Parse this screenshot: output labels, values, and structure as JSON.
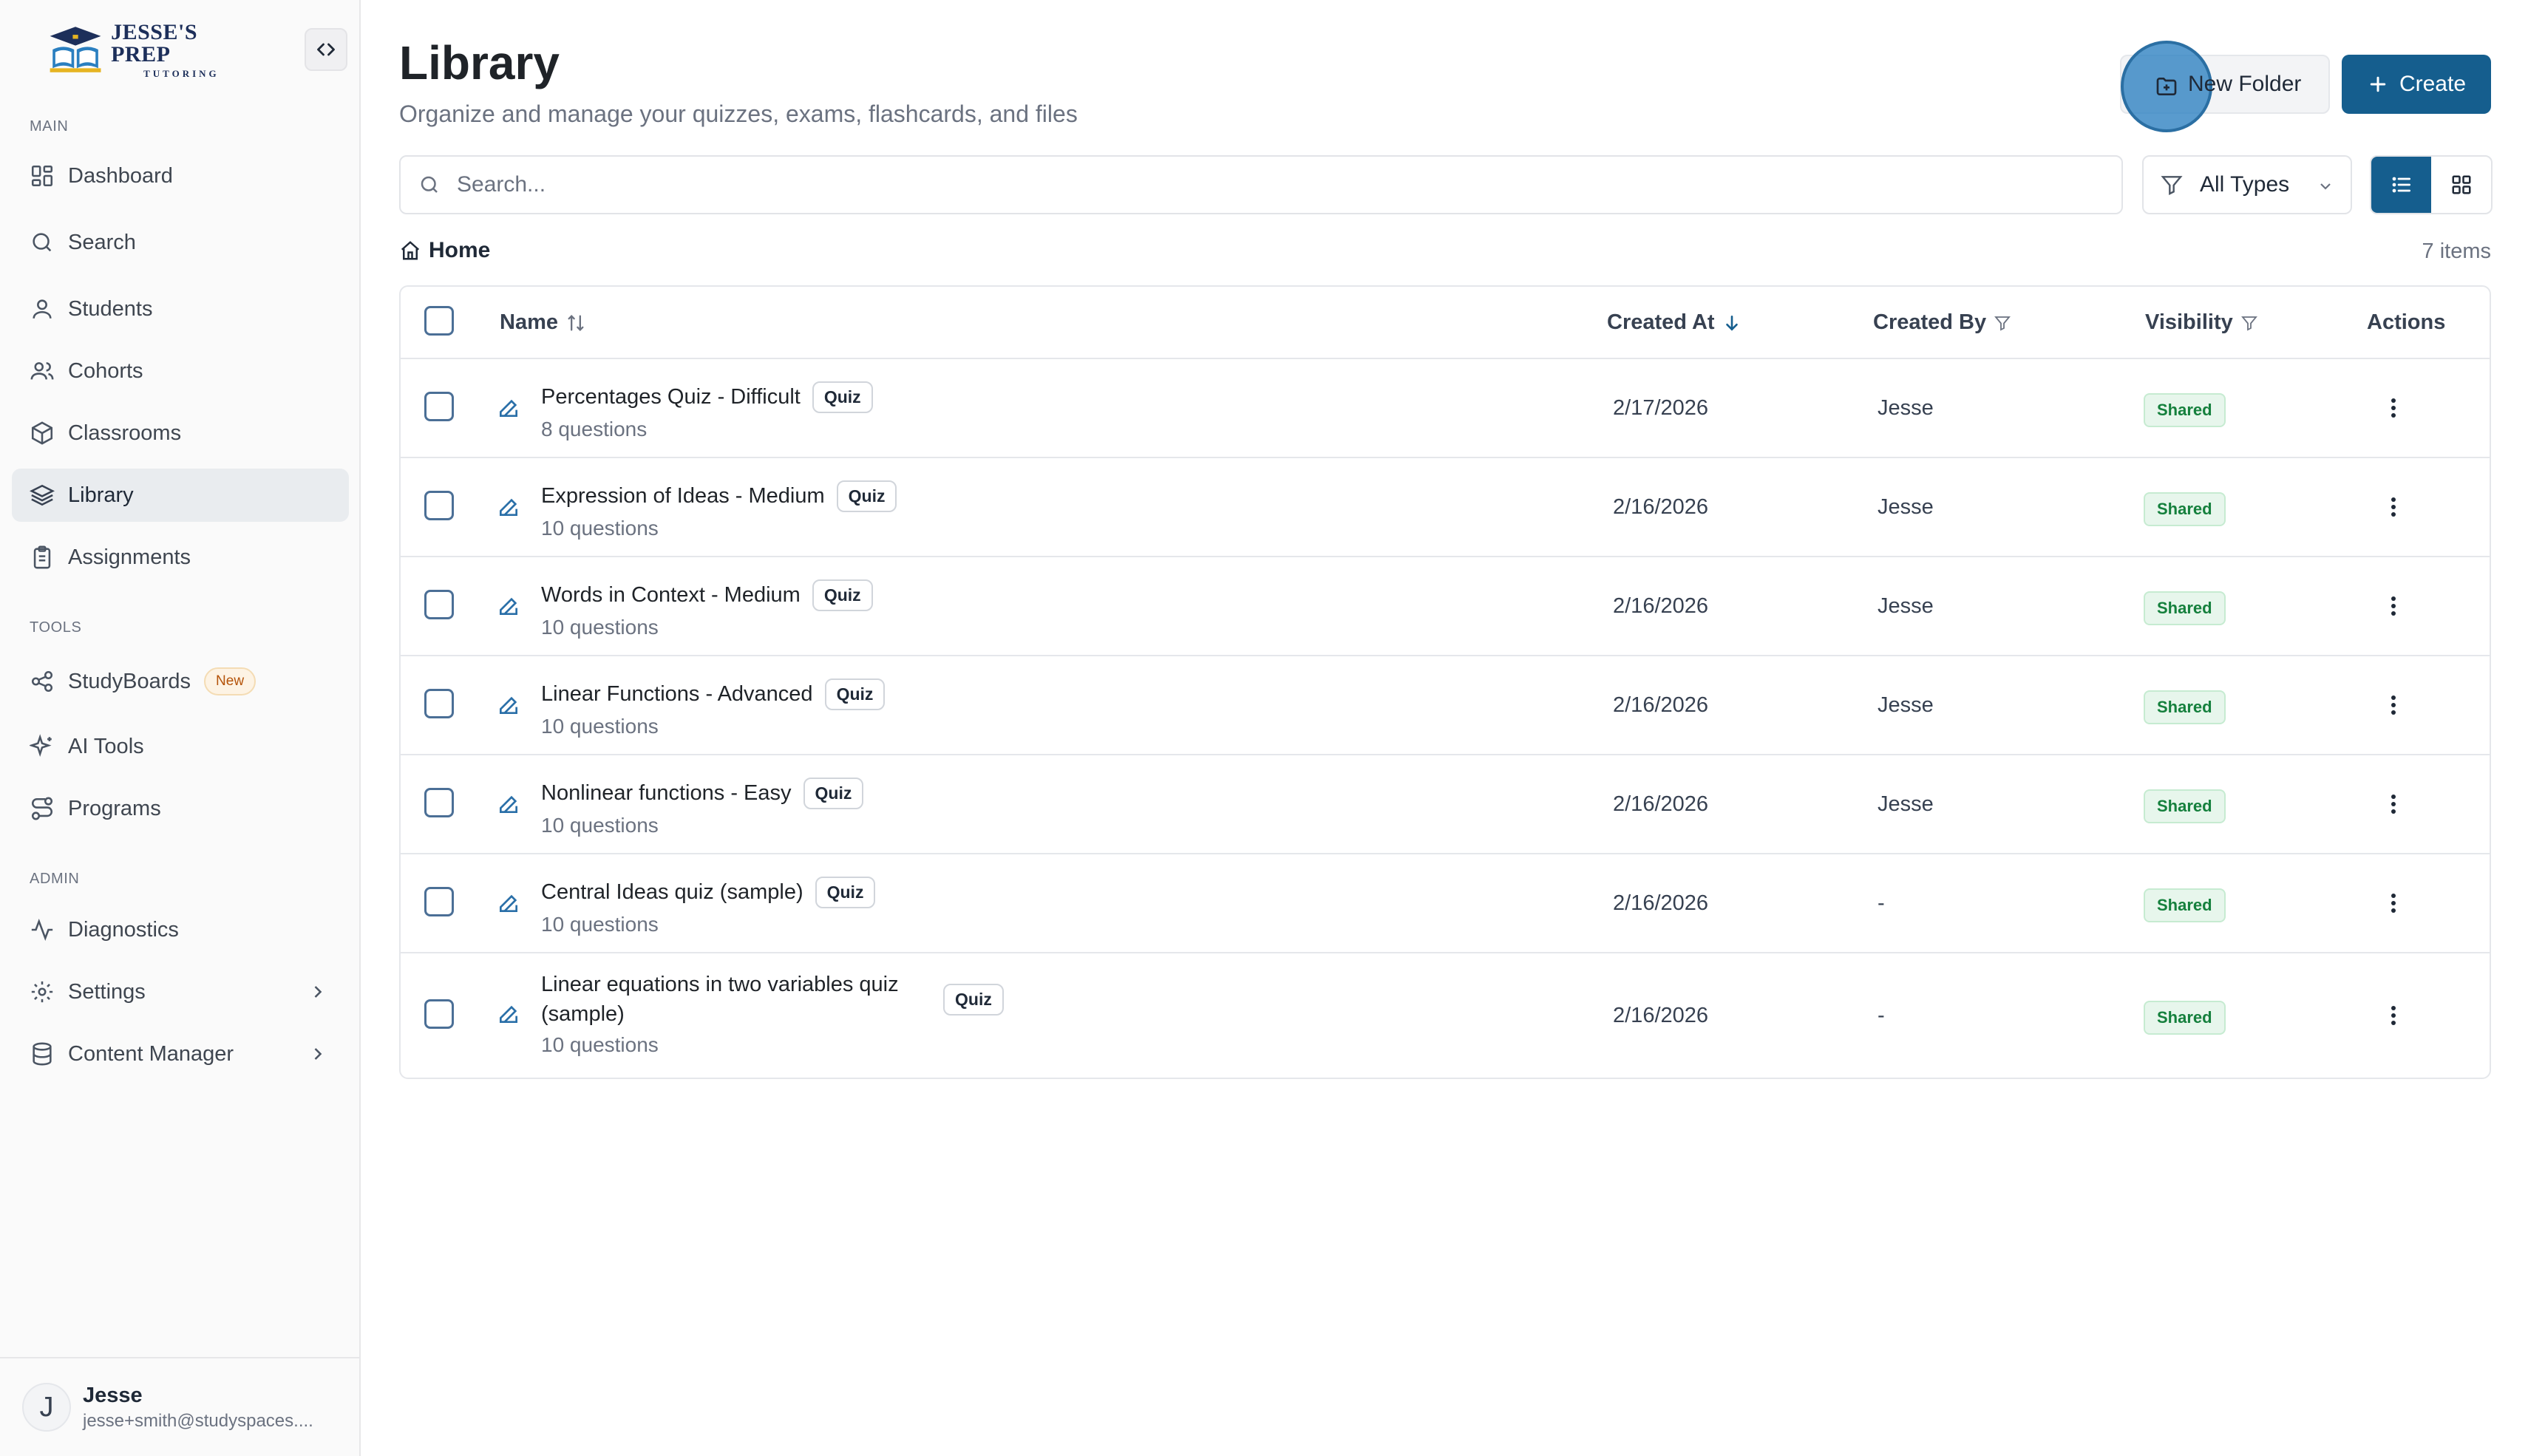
{
  "brand": {
    "title": "JESSE'S PREP",
    "subtitle": "TUTORING"
  },
  "sidebar": {
    "sections": {
      "main": "MAIN",
      "tools": "TOOLS",
      "admin": "ADMIN"
    },
    "items": {
      "dashboard": "Dashboard",
      "search": "Search",
      "students": "Students",
      "cohorts": "Cohorts",
      "classrooms": "Classrooms",
      "library": "Library",
      "assignments": "Assignments",
      "studyboards": "StudyBoards",
      "studyboards_badge": "New",
      "ai_tools": "AI Tools",
      "programs": "Programs",
      "diagnostics": "Diagnostics",
      "settings": "Settings",
      "content_manager": "Content Manager"
    },
    "user": {
      "initial": "J",
      "name": "Jesse",
      "email": "jesse+smith@studyspaces...."
    }
  },
  "header": {
    "title": "Library",
    "subtitle": "Organize and manage your quizzes, exams, flashcards, and files",
    "new_folder": "New Folder",
    "create": "Create"
  },
  "toolbar": {
    "search_placeholder": "Search...",
    "type_filter": "All Types"
  },
  "breadcrumb": {
    "home": "Home"
  },
  "count": "7 items",
  "table": {
    "columns": {
      "name": "Name",
      "created_at": "Created At",
      "created_by": "Created By",
      "visibility": "Visibility",
      "actions": "Actions"
    },
    "rows": [
      {
        "name": "Percentages Quiz - Difficult",
        "type": "Quiz",
        "sub": "8 questions",
        "date": "2/17/2026",
        "by": "Jesse",
        "visibility": "Shared"
      },
      {
        "name": "Expression of Ideas - Medium",
        "type": "Quiz",
        "sub": "10 questions",
        "date": "2/16/2026",
        "by": "Jesse",
        "visibility": "Shared"
      },
      {
        "name": "Words in Context - Medium",
        "type": "Quiz",
        "sub": "10 questions",
        "date": "2/16/2026",
        "by": "Jesse",
        "visibility": "Shared"
      },
      {
        "name": "Linear Functions - Advanced",
        "type": "Quiz",
        "sub": "10 questions",
        "date": "2/16/2026",
        "by": "Jesse",
        "visibility": "Shared"
      },
      {
        "name": "Nonlinear functions - Easy",
        "type": "Quiz",
        "sub": "10 questions",
        "date": "2/16/2026",
        "by": "Jesse",
        "visibility": "Shared"
      },
      {
        "name": "Central Ideas quiz (sample)",
        "type": "Quiz",
        "sub": "10 questions",
        "date": "2/16/2026",
        "by": "-",
        "visibility": "Shared"
      },
      {
        "name": "Linear equations in two variables quiz (sample)",
        "type": "Quiz",
        "sub": "10 questions",
        "date": "2/16/2026",
        "by": "-",
        "visibility": "Shared"
      }
    ]
  },
  "colors": {
    "accent": "#155e8e",
    "shared_text": "#15803d",
    "shared_bg": "#e7f6ec"
  },
  "icons": [
    "dashboard-icon",
    "search-icon",
    "students-icon",
    "cohorts-icon",
    "classrooms-icon",
    "library-icon",
    "assignments-icon",
    "studyboards-icon",
    "ai-tools-icon",
    "programs-icon",
    "diagnostics-icon",
    "settings-icon",
    "content-manager-icon",
    "folder-icon",
    "plus-icon",
    "filter-icon",
    "list-view-icon",
    "grid-view-icon",
    "home-icon",
    "edit-icon",
    "more-vertical-icon",
    "sort-icon",
    "arrow-down-icon"
  ]
}
